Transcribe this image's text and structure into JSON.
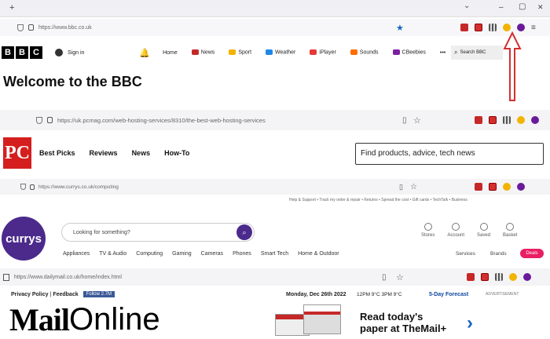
{
  "browser": {
    "new_tab_symbol": "+",
    "chevron": "⌄",
    "minimize": "–",
    "maximize": "▢",
    "close": "✕",
    "url": "https://www.bbc.co.uk",
    "menu": "≡"
  },
  "bbc": {
    "logo_letters": [
      "B",
      "B",
      "C"
    ],
    "signin": "Sign in",
    "nav": [
      {
        "label": "Home",
        "color": ""
      },
      {
        "label": "News",
        "color": "#c62828"
      },
      {
        "label": "Sport",
        "color": "#f2b400"
      },
      {
        "label": "Weather",
        "color": "#1e88e5"
      },
      {
        "label": "iPlayer",
        "color": "#e53935"
      },
      {
        "label": "Sounds",
        "color": "#ff6d00"
      },
      {
        "label": "CBeebies",
        "color": "#7b1fa2"
      }
    ],
    "more": "•••",
    "search": "Search BBC",
    "headline": "Welcome to the BBC"
  },
  "pcmag": {
    "url": "https://uk.pcmag.com/web-hosting-services/8310/the-best-web-hosting-services",
    "logo": "PC",
    "nav": [
      "Best Picks",
      "Reviews",
      "News",
      "How-To"
    ],
    "search_placeholder": "Find products, advice, tech news"
  },
  "currys": {
    "url": "https://www.currys.co.uk/computing",
    "top_links": "Help & Support  •  Track my order & repair  •  Returns  •  Spread the cost  •  Gift cards  •  TechTalk  •  Business",
    "logo": "currys",
    "search_placeholder": "Looking for something?",
    "icons": [
      "Stores",
      "Account",
      "Saved",
      "Basket"
    ],
    "categories": [
      "Appliances",
      "TV & Audio",
      "Computing",
      "Gaming",
      "Cameras",
      "Phones",
      "Smart Tech",
      "Home & Outdoor"
    ],
    "services": "Services",
    "brands": "Brands",
    "deals": "Deals"
  },
  "dailymail": {
    "url": "https://www.dailymail.co.uk/home/index.html",
    "privacy": "Privacy Policy",
    "feedback": "Feedback",
    "follow": "Follow 2.7M",
    "date": "Monday, Dec 26th 2022",
    "weather": "12PM 9°C  3PM 9°C",
    "forecast": "5-Day Forecast",
    "advert": "ADVERTISEMENT",
    "logo_mail": "Mail",
    "logo_online": "Online",
    "ad_line1": "Read today's",
    "ad_line2": "paper at TheMail+",
    "ad_arrow": "›"
  }
}
